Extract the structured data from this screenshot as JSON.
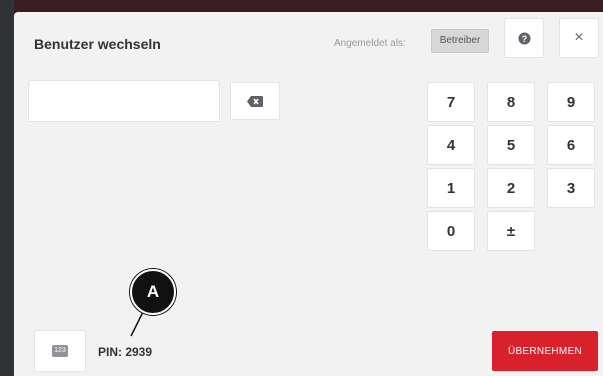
{
  "header": {
    "title": "Benutzer wechseln",
    "logged_in_label": "Angemeldet als:",
    "role": "Betreiber",
    "help_icon": "help-circle-icon",
    "close_icon": "close-icon",
    "close_glyph": "×"
  },
  "pin_input": {
    "value": ""
  },
  "keypad": {
    "keys": [
      "7",
      "8",
      "9",
      "4",
      "5",
      "6",
      "1",
      "2",
      "3",
      "0",
      "±"
    ]
  },
  "footer": {
    "keyboard_toggle_label": "123",
    "pin_text": "PIN: 2939",
    "submit_label": "ÜBERNEHMEN"
  },
  "callout": {
    "label": "A"
  },
  "colors": {
    "accent": "#d9212c",
    "background": "#f2f2f2"
  }
}
